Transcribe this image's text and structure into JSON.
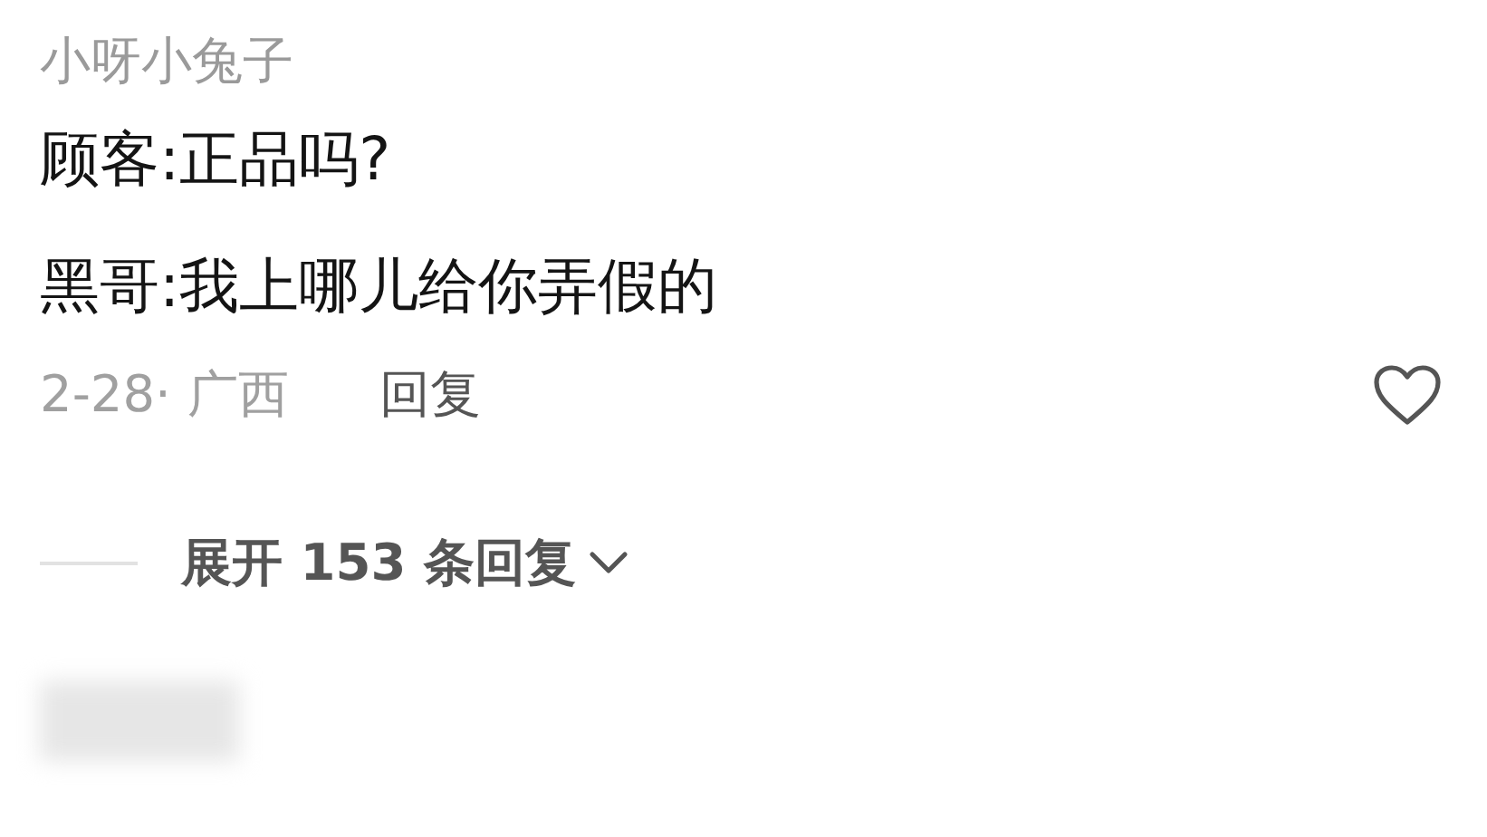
{
  "comment": {
    "author": "小呀小兔子",
    "lines": [
      "顾客:正品吗?",
      "黑哥:我上哪儿给你弄假的"
    ],
    "meta": "2-28· 广西",
    "reply": "回复"
  },
  "expand": "展开 153 条回复",
  "next_comment": {
    "author_hidden": true
  }
}
